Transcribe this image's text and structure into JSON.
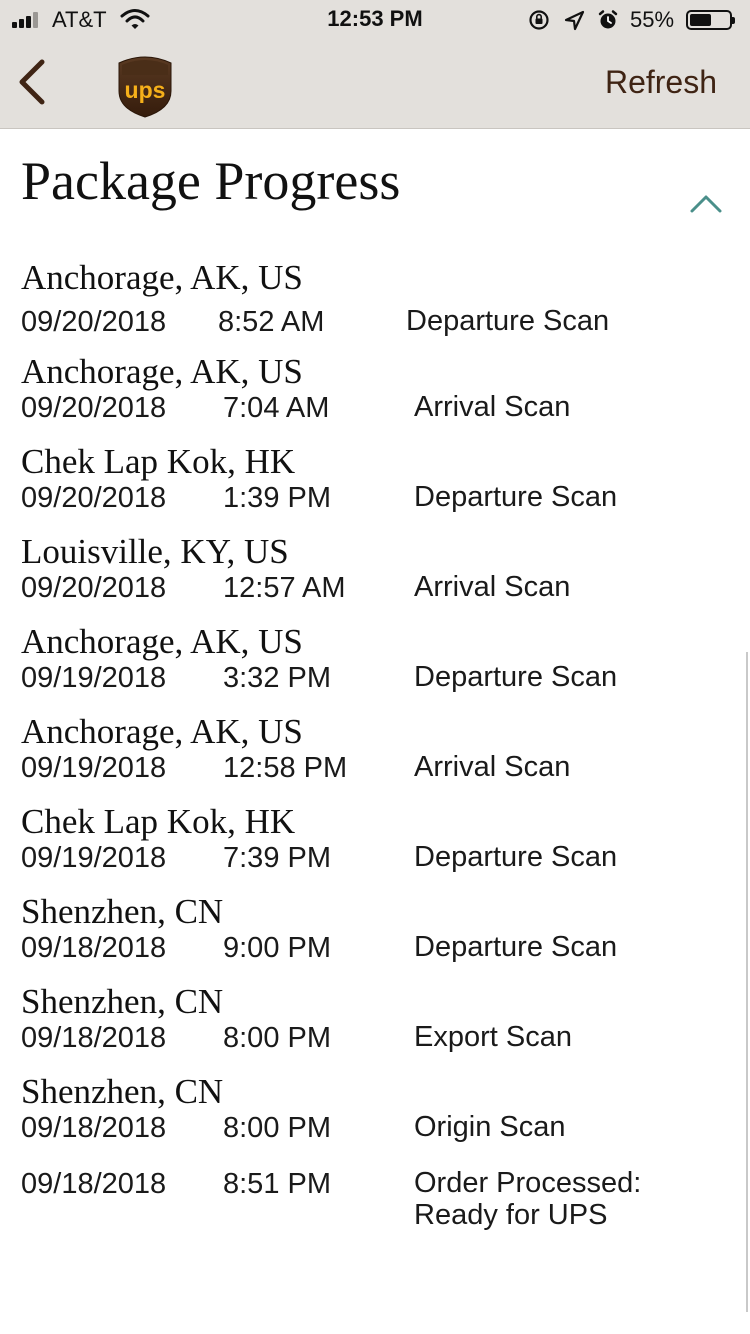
{
  "status_bar": {
    "carrier": "AT&T",
    "time": "12:53 PM",
    "battery_percent": "55%",
    "battery_level": 0.55,
    "icons": [
      "signal-icon",
      "wifi-icon",
      "orientation-lock-icon",
      "location-arrow-icon",
      "alarm-icon",
      "battery-icon"
    ]
  },
  "nav": {
    "back_icon": "chevron-left-icon",
    "logo_text": "ups",
    "refresh_label": "Refresh"
  },
  "colors": {
    "nav_background": "#e3e0dc",
    "brand_brown": "#3f2414",
    "brand_gold": "#f6b01a",
    "toggle_teal": "#4a8f8a"
  },
  "main": {
    "title": "Package Progress",
    "collapse_icon": "chevron-up-icon",
    "events": [
      {
        "location": "Anchorage, AK, US",
        "date": "09/20/2018",
        "time": "8:52 AM",
        "activity": "Departure Scan"
      },
      {
        "location": "Anchorage, AK, US",
        "date": "09/20/2018",
        "time": "7:04 AM",
        "activity": "Arrival Scan"
      },
      {
        "location": "Chek Lap Kok, HK",
        "date": "09/20/2018",
        "time": "1:39 PM",
        "activity": "Departure Scan"
      },
      {
        "location": "Louisville, KY, US",
        "date": "09/20/2018",
        "time": "12:57 AM",
        "activity": "Arrival Scan"
      },
      {
        "location": "Anchorage, AK, US",
        "date": "09/19/2018",
        "time": "3:32 PM",
        "activity": "Departure Scan"
      },
      {
        "location": "Anchorage, AK, US",
        "date": "09/19/2018",
        "time": "12:58 PM",
        "activity": "Arrival Scan"
      },
      {
        "location": "Chek Lap Kok, HK",
        "date": "09/19/2018",
        "time": "7:39 PM",
        "activity": "Departure Scan"
      },
      {
        "location": "Shenzhen, CN",
        "date": "09/18/2018",
        "time": "9:00 PM",
        "activity": "Departure Scan"
      },
      {
        "location": "Shenzhen, CN",
        "date": "09/18/2018",
        "time": "8:00 PM",
        "activity": "Export Scan"
      },
      {
        "location": "Shenzhen, CN",
        "date": "09/18/2018",
        "time": "8:00 PM",
        "activity": "Origin Scan"
      },
      {
        "location": "",
        "date": "09/18/2018",
        "time": "8:51 PM",
        "activity": "Order Processed:\nReady for UPS"
      }
    ]
  }
}
